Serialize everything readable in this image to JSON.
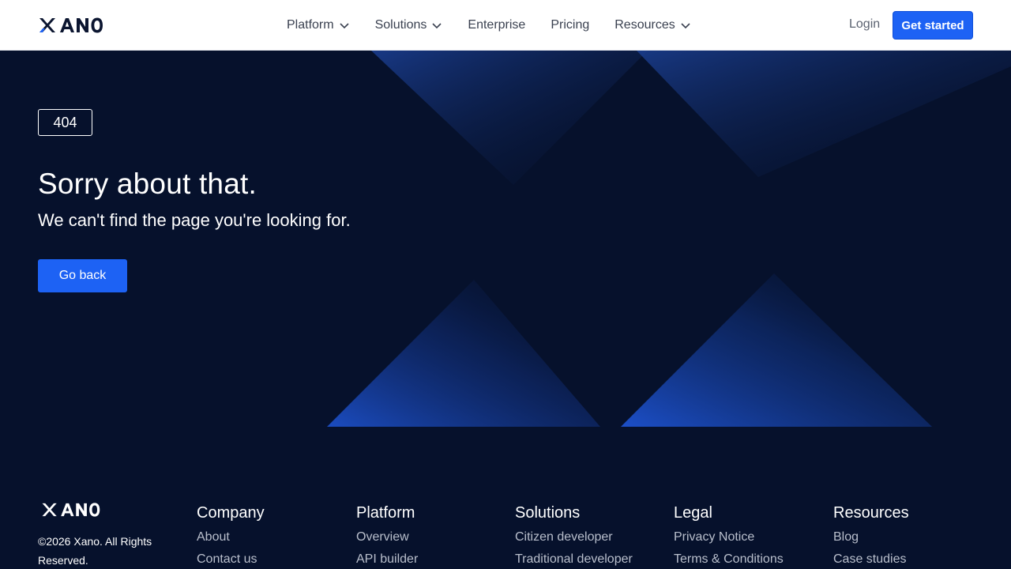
{
  "header": {
    "logo_text": "XANO",
    "nav": [
      {
        "label": "Platform",
        "has_dropdown": true
      },
      {
        "label": "Solutions",
        "has_dropdown": true
      },
      {
        "label": "Enterprise",
        "has_dropdown": false
      },
      {
        "label": "Pricing",
        "has_dropdown": false
      },
      {
        "label": "Resources",
        "has_dropdown": true
      }
    ],
    "login_label": "Login",
    "cta_label": "Get started"
  },
  "hero": {
    "badge": "404",
    "title": "Sorry about that.",
    "subtitle": "We can't find the page you're looking for.",
    "button_label": "Go back"
  },
  "footer": {
    "logo_text": "XANO",
    "copyright": "©2026 Xano. All Rights Reserved.",
    "columns": [
      {
        "heading": "Company",
        "links": [
          "About",
          "Contact us"
        ]
      },
      {
        "heading": "Platform",
        "links": [
          "Overview",
          "API builder"
        ]
      },
      {
        "heading": "Solutions",
        "links": [
          "Citizen developer",
          "Traditional developer"
        ]
      },
      {
        "heading": "Legal",
        "links": [
          "Privacy Notice",
          "Terms & Conditions"
        ]
      },
      {
        "heading": "Resources",
        "links": [
          "Blog",
          "Case studies"
        ]
      }
    ]
  },
  "colors": {
    "brand_blue": "#1d62f4",
    "navy_background": "#06112c",
    "header_background": "#ffffff"
  }
}
